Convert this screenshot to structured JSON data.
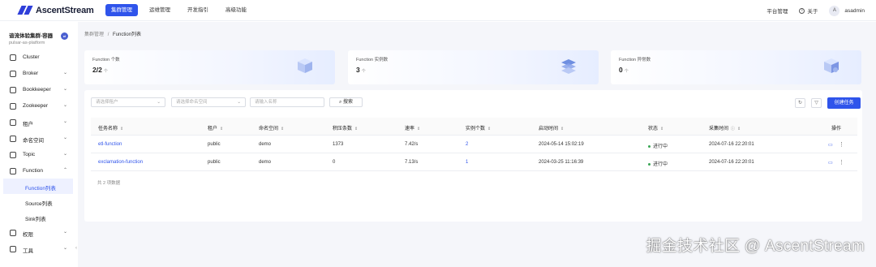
{
  "brand": {
    "name": "AscentStream"
  },
  "nav": {
    "items": [
      "集群管理",
      "运维管理",
      "开发指引",
      "高级功能"
    ],
    "active_index": 0
  },
  "topright": {
    "platform": "平台管理",
    "about": "关于",
    "avatar_letter": "A",
    "username": "asadmin"
  },
  "sidebar": {
    "cluster_name": "谙流体验集群-容器",
    "cluster_sub": "pulsar-as-platform",
    "items": [
      {
        "label": "Cluster",
        "icon": "cluster-icon"
      },
      {
        "label": "Broker",
        "icon": "broker-icon"
      },
      {
        "label": "Bookkeeper",
        "icon": "bookkeeper-icon"
      },
      {
        "label": "Zookeeper",
        "icon": "zookeeper-icon"
      },
      {
        "label": "租户",
        "icon": "tenant-icon"
      },
      {
        "label": "命名空间",
        "icon": "namespace-icon"
      },
      {
        "label": "Topic",
        "icon": "topic-icon"
      },
      {
        "label": "Function",
        "icon": "function-icon"
      },
      {
        "label": "Function列表",
        "icon": ""
      },
      {
        "label": "Source列表",
        "icon": ""
      },
      {
        "label": "Sink列表",
        "icon": ""
      },
      {
        "label": "权限",
        "icon": "permission-icon"
      },
      {
        "label": "工具",
        "icon": "tools-icon"
      }
    ],
    "selected": "Function列表"
  },
  "breadcrumb": {
    "parent": "集群管理",
    "sep": "/",
    "current": "Function列表"
  },
  "stats": [
    {
      "label": "Function 个数",
      "value": "2/2",
      "unit": "个"
    },
    {
      "label": "Function 实例数",
      "value": "3",
      "unit": "个"
    },
    {
      "label": "Function 异常数",
      "value": "0",
      "unit": "个"
    }
  ],
  "filters": {
    "tenant_placeholder": "请选择租户",
    "namespace_placeholder": "请选择命名空间",
    "name_placeholder": "请输入名称",
    "search_label": "搜索",
    "create_label": "创建任务"
  },
  "table": {
    "headers": [
      "任务名称",
      "租户",
      "命名空间",
      "积压条数",
      "速率",
      "实例个数",
      "启动时间",
      "状态",
      "采集时间",
      "操作"
    ],
    "rows": [
      {
        "name": "etl-function",
        "tenant": "public",
        "namespace": "demo",
        "backlog": "1373",
        "rate": "7.42/s",
        "instances": "2",
        "start": "2024-05-14 15:02:19",
        "status": "进行中",
        "collected": "2024-07-16 22:20:01"
      },
      {
        "name": "exclamation-function",
        "tenant": "public",
        "namespace": "demo",
        "backlog": "0",
        "rate": "7.13/s",
        "instances": "1",
        "start": "2024-03-25 11:16:39",
        "status": "进行中",
        "collected": "2024-07-16 22:20:01"
      }
    ],
    "total": "共 2 项数据"
  },
  "watermark": "掘金技术社区 @ AscentStream",
  "colors": {
    "primary": "#2f54eb",
    "running": "#3aa655"
  }
}
